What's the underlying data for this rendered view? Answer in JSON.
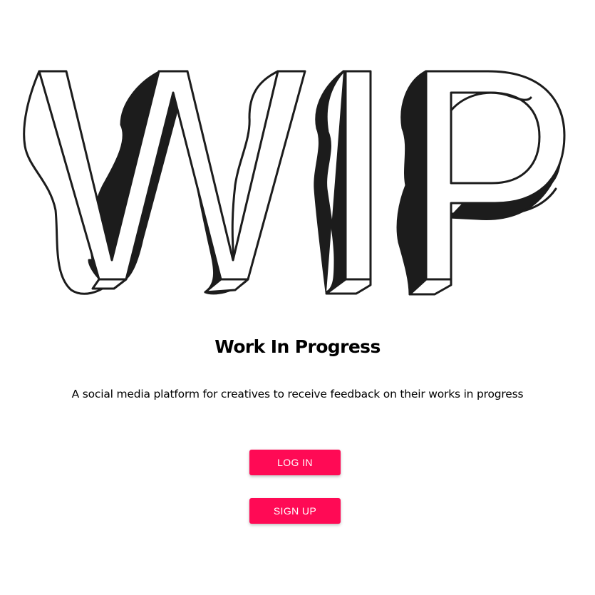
{
  "logo": {
    "text": "WIP",
    "icon": "wip-3d-wordmark"
  },
  "hero": {
    "title": "Work In Progress",
    "tagline": "A social media platform for creatives to receive feedback on their works in progress"
  },
  "actions": {
    "login_label": "LOG IN",
    "signup_label": "SIGN UP"
  },
  "colors": {
    "accent": "#ff0a55",
    "background": "#ffffff",
    "text": "#000000"
  }
}
